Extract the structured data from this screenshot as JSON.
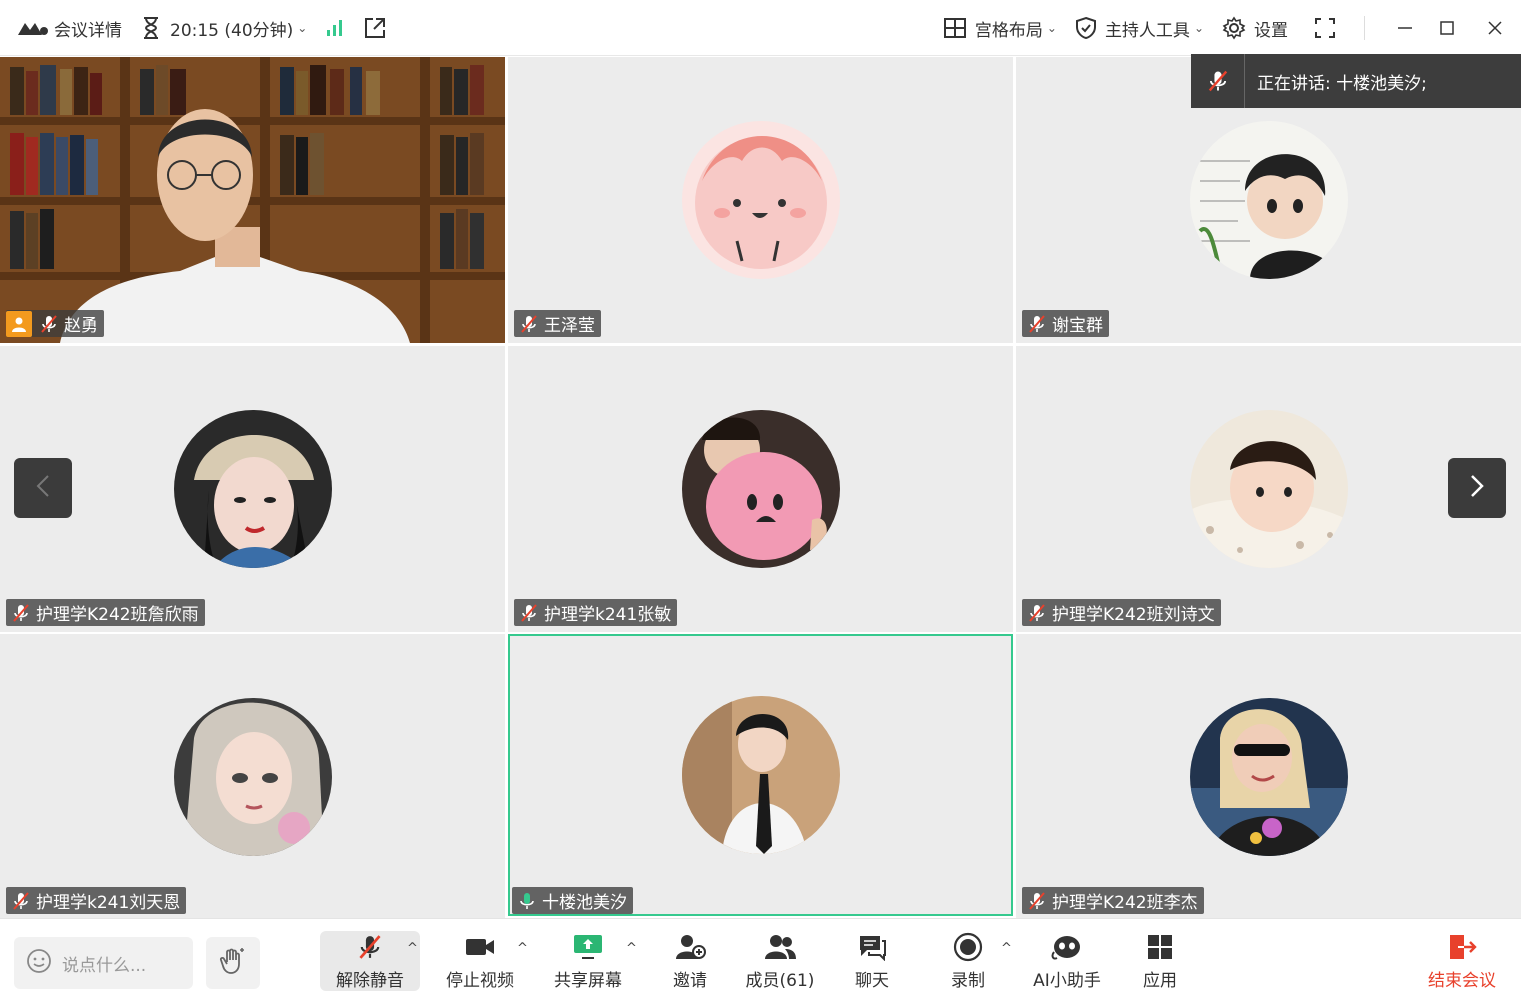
{
  "topbar": {
    "meeting_details": "会议详情",
    "timer": "20:15 (40分钟)",
    "layout": "宫格布局",
    "host_tools": "主持人工具",
    "settings": "设置"
  },
  "speaking": {
    "label": "正在讲话:  十楼池美汐;"
  },
  "participants": [
    {
      "name": "赵勇",
      "host": true
    },
    {
      "name": "王泽莹"
    },
    {
      "name": "谢宝群"
    },
    {
      "name": "护理学K242班詹欣雨"
    },
    {
      "name": "护理学k241张敏"
    },
    {
      "name": "护理学K242班刘诗文"
    },
    {
      "name": "护理学k241刘天恩"
    },
    {
      "name": "十楼池美汐",
      "speaking": true
    },
    {
      "name": "护理学K242班李杰"
    }
  ],
  "toolbar": {
    "chat_placeholder": "说点什么...",
    "unmute": "解除静音",
    "stop_video": "停止视频",
    "share_screen": "共享屏幕",
    "invite": "邀请",
    "members": "成员(61)",
    "chat": "聊天",
    "record": "录制",
    "ai_assistant": "AI小助手",
    "apps": "应用",
    "end_meeting": "结束会议"
  },
  "colors": {
    "accent_green": "#35c98e",
    "end_red": "#e8412c",
    "host_orange": "#f39a1e"
  }
}
